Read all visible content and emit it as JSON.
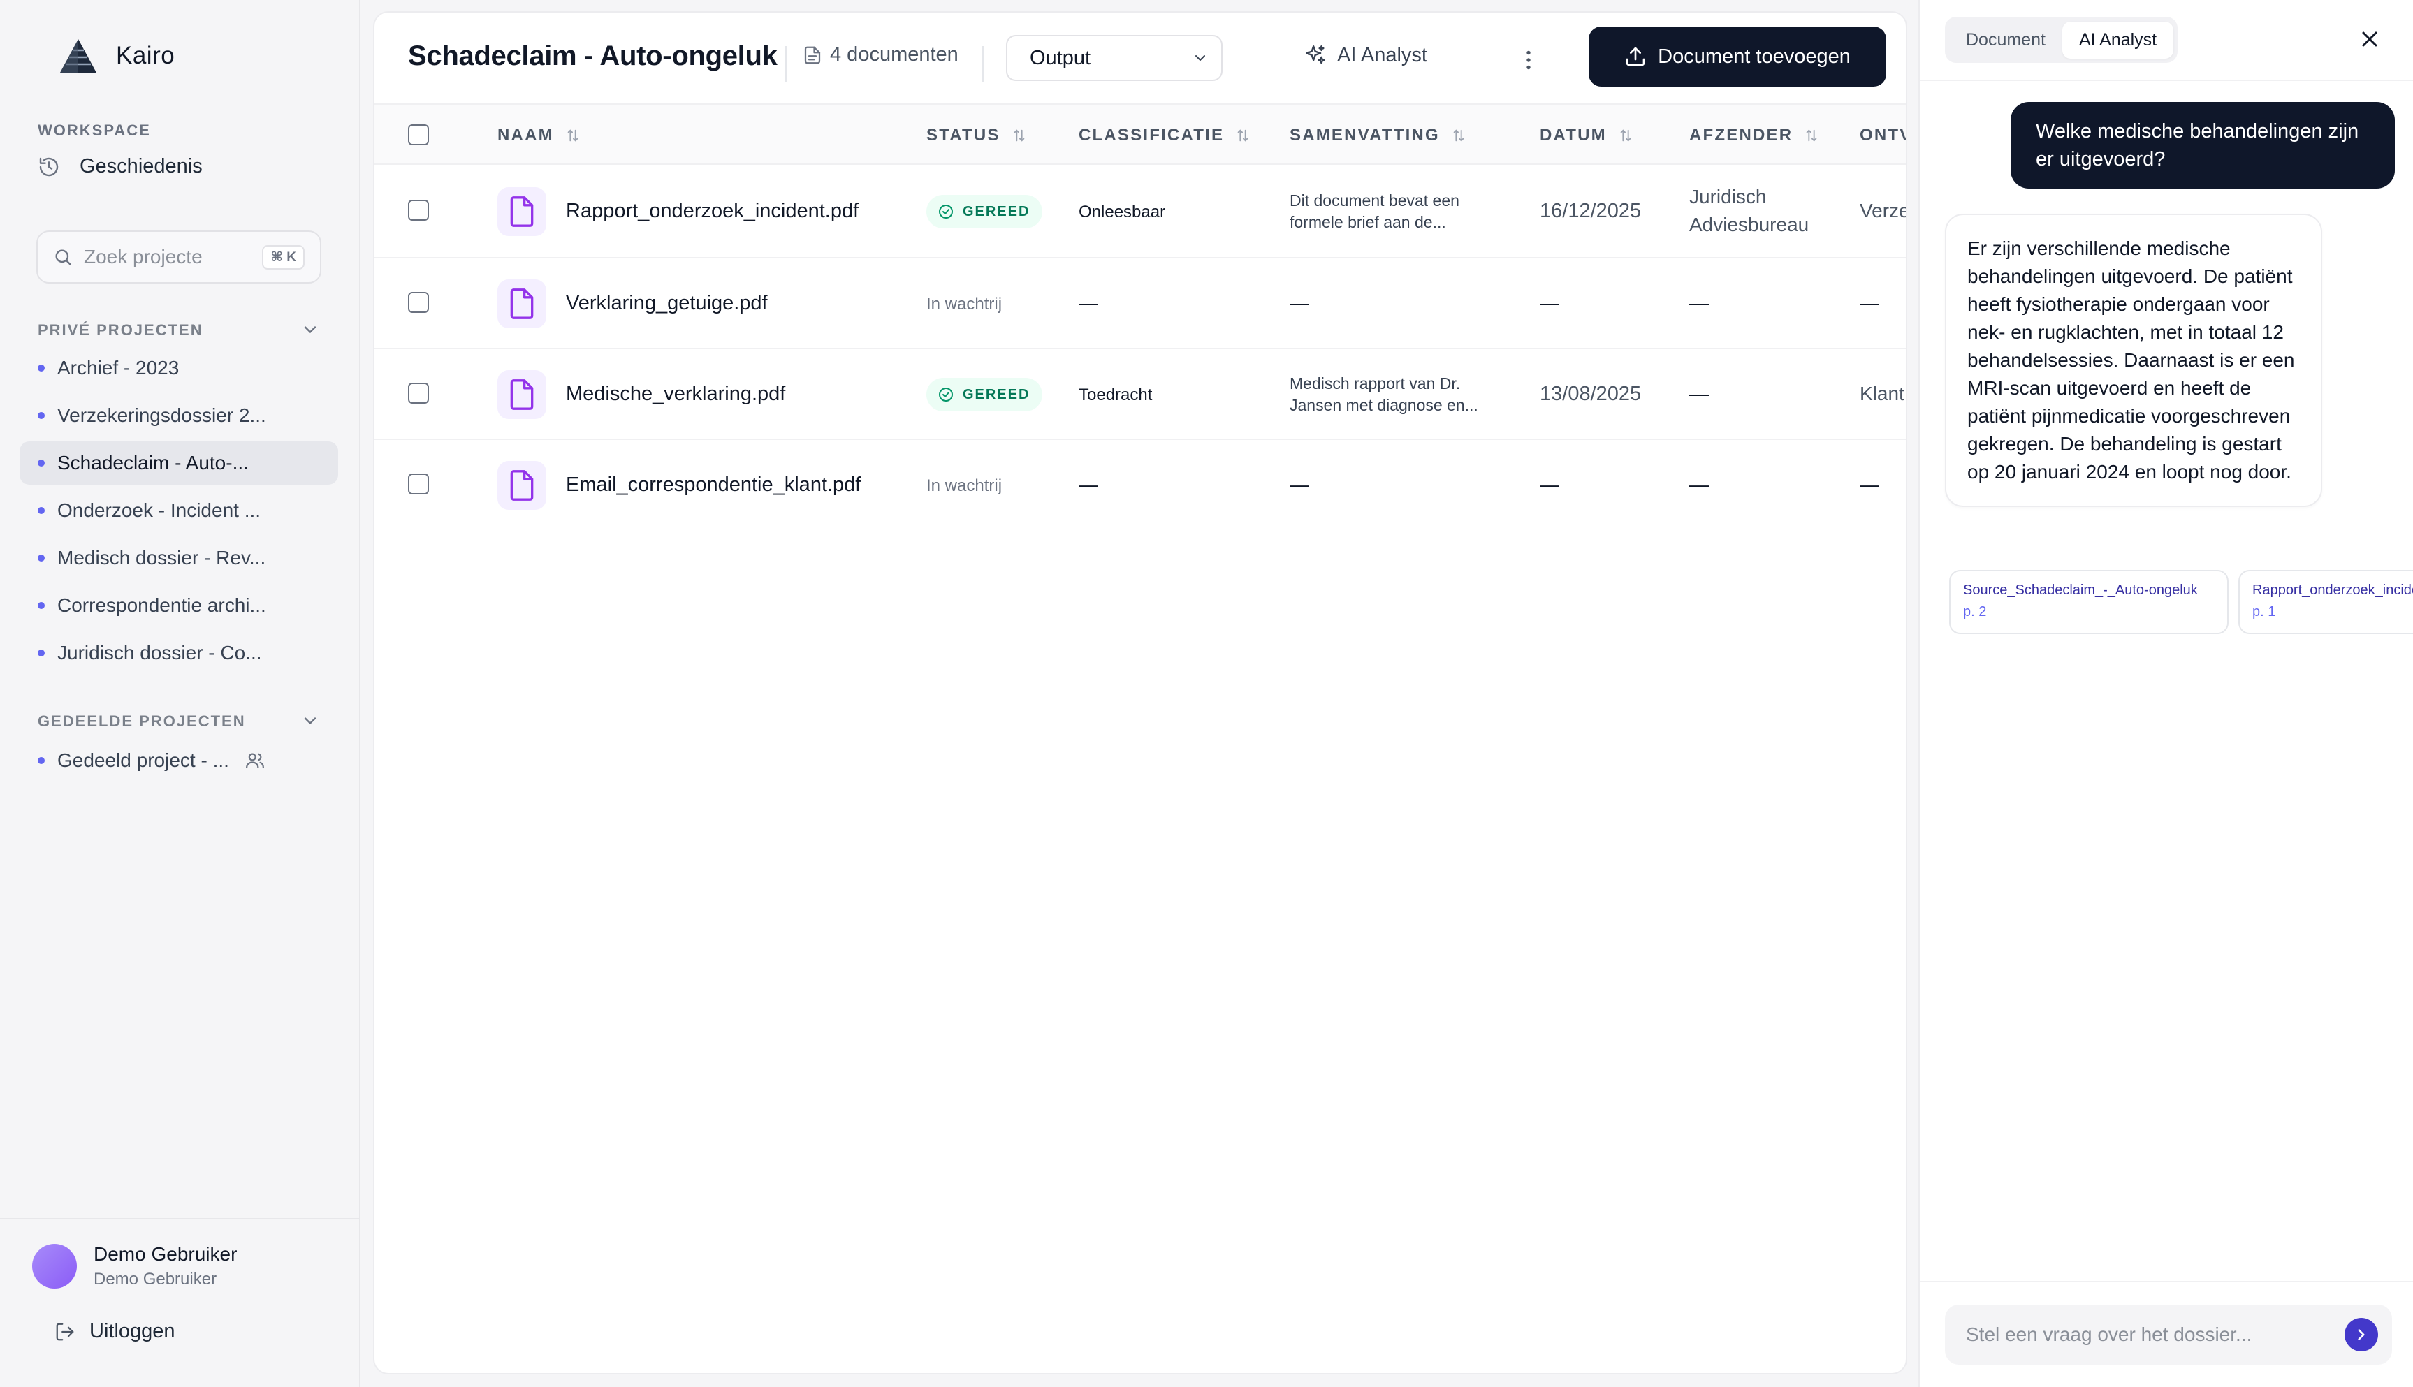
{
  "app": {
    "name": "Kairo"
  },
  "sidebar": {
    "workspace_label": "WORKSPACE",
    "history_label": "Geschiedenis",
    "search": {
      "placeholder": "Zoek projecte",
      "shortcut": "⌘ K"
    },
    "private_label": "PRIVÉ PROJECTEN",
    "private_projects": [
      {
        "label": "Archief - 2023"
      },
      {
        "label": "Verzekeringsdossier 2..."
      },
      {
        "label": "Schadeclaim - Auto-..."
      },
      {
        "label": "Onderzoek - Incident ..."
      },
      {
        "label": "Medisch dossier - Rev..."
      },
      {
        "label": "Correspondentie archi..."
      },
      {
        "label": "Juridisch dossier - Co..."
      }
    ],
    "shared_label": "GEDEELDE PROJECTEN",
    "shared_projects": [
      {
        "label": "Gedeeld project - ..."
      }
    ],
    "user": {
      "name": "Demo Gebruiker",
      "subtitle": "Demo Gebruiker"
    },
    "logout_label": "Uitloggen"
  },
  "main": {
    "title": "Schadeclaim - Auto-ongeluk",
    "doc_count": "4 documenten",
    "output_select": "Output",
    "ai_button": "AI Analyst",
    "add_button": "Document toevoegen",
    "columns": {
      "name": "NAAM",
      "status": "STATUS",
      "classification": "CLASSIFICATIE",
      "summary": "SAMENVATTING",
      "date": "DATUM",
      "sender": "AFZENDER",
      "receiver": "ONTV"
    },
    "rows": [
      {
        "name": "Rapport_onderzoek_incident.pdf",
        "status": "GEREED",
        "classification": "Onleesbaar",
        "summary": "Dit document bevat een formele brief aan de...",
        "date": "16/12/2025",
        "sender": "Juridisch Adviesbureau",
        "receiver": "Verze"
      },
      {
        "name": "Verklaring_getuige.pdf",
        "status": "In wachtrij",
        "classification": "—",
        "summary": "—",
        "date": "—",
        "sender": "—",
        "receiver": "—"
      },
      {
        "name": "Medische_verklaring.pdf",
        "status": "GEREED",
        "classification": "Toedracht",
        "summary": "Medisch rapport van Dr. Jansen met diagnose en...",
        "date": "13/08/2025",
        "sender": "—",
        "receiver": "Klant"
      },
      {
        "name": "Email_correspondentie_klant.pdf",
        "status": "In wachtrij",
        "classification": "—",
        "summary": "—",
        "date": "—",
        "sender": "—",
        "receiver": "—"
      }
    ]
  },
  "panel": {
    "tabs": [
      {
        "label": "Document"
      },
      {
        "label": "AI Analyst"
      }
    ],
    "active_tab": "AI Analyst",
    "user_message": "Welke medische behandelingen zijn er uitgevoerd?",
    "ai_message": "Er zijn verschillende medische behandelingen uitgevoerd. De patiënt heeft fysiotherapie ondergaan voor nek- en rugklachten, met in totaal 12 behandelsessies. Daarnaast is er een MRI-scan uitgevoerd en heeft de patiënt pijnmedicatie voorgeschreven gekregen. De behandeling is gestart op 20 januari 2024 en loopt nog door.",
    "sources": [
      {
        "name": "Source_Schadeclaim_-_Auto-ongeluk",
        "page": "p. 2"
      },
      {
        "name": "Rapport_onderzoek_incident.pdf",
        "page": "p. 1"
      }
    ],
    "input_placeholder": "Stel een vraag over het dossier..."
  },
  "colors": {
    "accent": "#4338ca",
    "primary_button": "#0f172a",
    "status_done_bg": "#ecfdf5",
    "status_done_text": "#047857",
    "file_icon": "#9333ea"
  }
}
